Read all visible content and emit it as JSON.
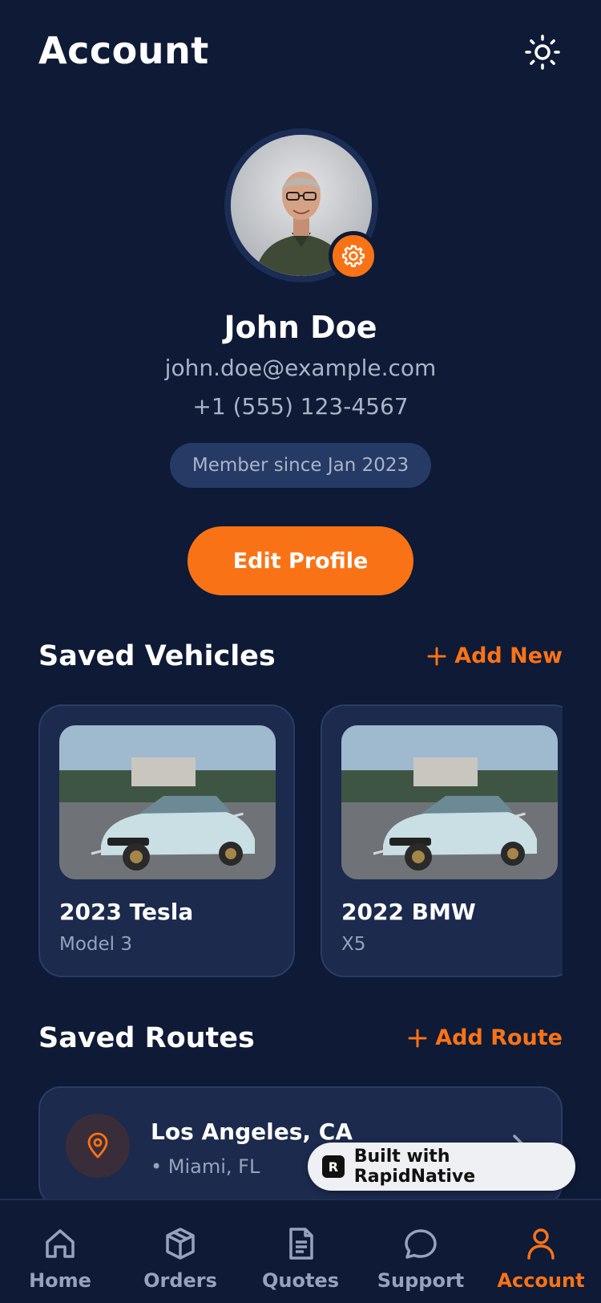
{
  "header": {
    "title": "Account",
    "theme_icon": "sun-icon"
  },
  "profile": {
    "name": "John Doe",
    "email": "john.doe@example.com",
    "phone": "+1 (555) 123-4567",
    "member_since": "Member since Jan 2023",
    "edit_label": "Edit Profile",
    "avatar_badge_icon": "gear-icon"
  },
  "vehicles": {
    "title": "Saved Vehicles",
    "action_label": "Add New",
    "items": [
      {
        "name": "2023 Tesla",
        "model": "Model 3"
      },
      {
        "name": "2022 BMW",
        "model": "X5"
      }
    ]
  },
  "routes": {
    "title": "Saved Routes",
    "action_label": "Add Route",
    "items": [
      {
        "from": "Los Angeles, CA",
        "to": "• Miami, FL",
        "icon": "map-pin-icon"
      }
    ]
  },
  "badge": {
    "label": "Built with RapidNative"
  },
  "nav": {
    "items": [
      {
        "label": "Home",
        "icon": "home-icon"
      },
      {
        "label": "Orders",
        "icon": "box-icon"
      },
      {
        "label": "Quotes",
        "icon": "document-icon"
      },
      {
        "label": "Support",
        "icon": "chat-icon"
      },
      {
        "label": "Account",
        "icon": "user-icon",
        "active": true
      }
    ]
  },
  "colors": {
    "background": "#0e1a36",
    "accent": "#f97316",
    "card": "#1b2a4d",
    "muted": "#97a3bd"
  }
}
